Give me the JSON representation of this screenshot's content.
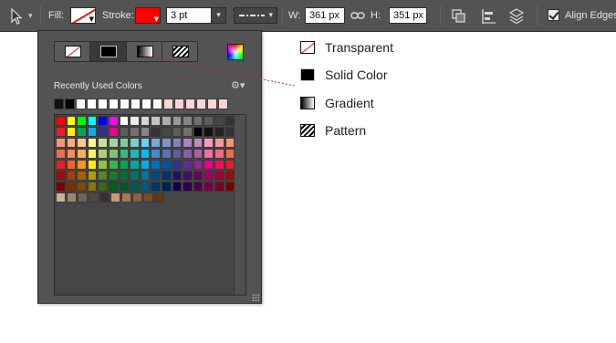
{
  "toolbar": {
    "fill_label": "Fill:",
    "stroke_label": "Stroke:",
    "fill_swatch": "transparent",
    "stroke_color": "#ff0000",
    "stroke_width": "3 pt",
    "w_label": "W:",
    "width_value": "361 px",
    "h_label": "H:",
    "height_value": "351 px",
    "align_edges_label": "Align Edges",
    "align_edges_checked": true
  },
  "panel": {
    "type_buttons": [
      {
        "name": "no-color",
        "icon": "transparent-icon"
      },
      {
        "name": "solid-color",
        "icon": "solid-color-icon",
        "active": true
      },
      {
        "name": "gradient",
        "icon": "gradient-icon"
      },
      {
        "name": "pattern",
        "icon": "pattern-icon"
      }
    ],
    "recent_label": "Recently Used Colors",
    "recent_colors": [
      "#111111",
      "#000000",
      "#ffffff",
      "#ffffff",
      "#ffffff",
      "#ffffff",
      "#ffffff",
      "#ffffff",
      "#ffffff",
      "#ffffff",
      "#ffd4d4",
      "#ffd4d4",
      "#ffd4d4",
      "#ffd4d4",
      "#ffd4d4",
      "#ffd4d4"
    ],
    "swatch_rows": [
      [
        "#ff0000",
        "#ffff00",
        "#00ff00",
        "#00ffff",
        "#0000ff",
        "#ff00ff",
        "#ffffff",
        "#ebebeb",
        "#d6d6d6",
        "#c2c2c2",
        "#adadad",
        "#999999",
        "#858585",
        "#707070",
        "#5c5c5c",
        "#474747",
        "#333333"
      ],
      [
        "#ee1d24",
        "#fff100",
        "#00a650",
        "#00aeef",
        "#2f3192",
        "#ed008c",
        "#5c5c5c",
        "#707070",
        "#858585",
        "#333333",
        "#474747",
        "#5c5c5c",
        "#707070",
        "#000000",
        "#111111",
        "#222222",
        "#333333"
      ],
      [
        "#f7977a",
        "#fbad82",
        "#fdc68c",
        "#fff799",
        "#c6df9c",
        "#a4d49d",
        "#81ca9d",
        "#7bcdc9",
        "#6ccff7",
        "#7ca6d8",
        "#8293ca",
        "#8881be",
        "#a286bd",
        "#bc8cbf",
        "#f49bc1",
        "#f5999d",
        "#f7977a"
      ],
      [
        "#f26c4f",
        "#f68e55",
        "#fbaf5a",
        "#fff467",
        "#acd372",
        "#7dc473",
        "#39b778",
        "#16bcb4",
        "#00bff3",
        "#438ccb",
        "#5573b7",
        "#5e5ca7",
        "#855fa8",
        "#a763a9",
        "#ef6ea8",
        "#f16d7e",
        "#f26c4f"
      ],
      [
        "#ee1d24",
        "#f16522",
        "#f7941d",
        "#fff100",
        "#8fc63d",
        "#37b44a",
        "#00a650",
        "#00a99e",
        "#00aeef",
        "#0072bc",
        "#0054a5",
        "#2f3192",
        "#652c91",
        "#91278f",
        "#ed008c",
        "#ee105a",
        "#ee1d24"
      ],
      [
        "#9d0a0f",
        "#a1410d",
        "#a36209",
        "#aba000",
        "#588528",
        "#197b30",
        "#007236",
        "#00736a",
        "#0076a4",
        "#004a80",
        "#003370",
        "#1d1363",
        "#450e61",
        "#62055f",
        "#9e005c",
        "#9d0039",
        "#9d0a0f"
      ],
      [
        "#790000",
        "#7b3000",
        "#7c4900",
        "#827a00",
        "#3e6617",
        "#045f20",
        "#005824",
        "#005951",
        "#005b7e",
        "#003562",
        "#002056",
        "#0c004b",
        "#30004a",
        "#4b0048",
        "#7a0045",
        "#7a0026",
        "#790000"
      ],
      [
        "#c7b299",
        "#998675",
        "#736357",
        "#534741",
        "#37302d",
        "#c69c6d",
        "#a67c52",
        "#8c6239",
        "#754c24",
        "#603813"
      ]
    ]
  },
  "legend": [
    {
      "icon": "transparent-icon",
      "label": "Transparent"
    },
    {
      "icon": "solid-color-icon",
      "label": "Solid Color"
    },
    {
      "icon": "gradient-icon",
      "label": "Gradient"
    },
    {
      "icon": "pattern-icon",
      "label": "Pattern"
    }
  ]
}
